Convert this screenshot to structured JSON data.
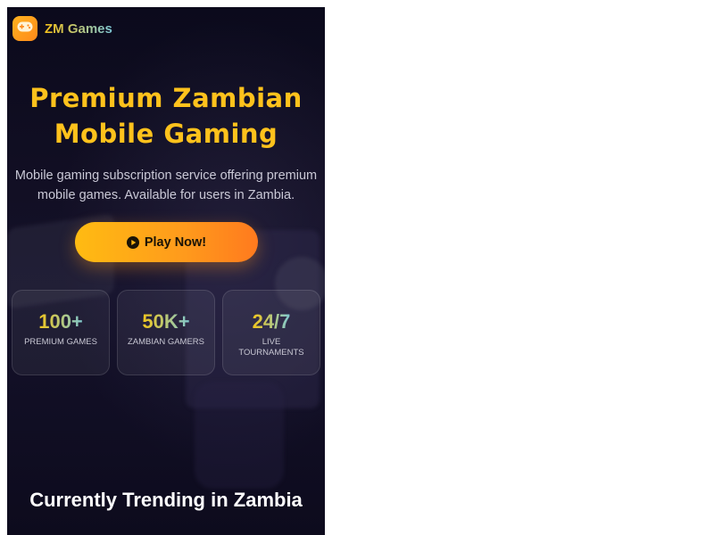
{
  "header": {
    "brand": "ZM Games",
    "logo_icon": "gamepad-icon"
  },
  "hero": {
    "title_line1": "Premium Zambian",
    "title_line2": "Mobile Gaming",
    "subtitle_line1": "Mobile gaming subscription service offering premium",
    "subtitle_line2": "mobile games. Available for users in Zambia.",
    "cta_label": "Play Now!",
    "cta_icon": "play-circle-icon"
  },
  "stats": [
    {
      "value": "100+",
      "label": "Premium Games"
    },
    {
      "value": "50K+",
      "label": "Zambian Gamers"
    },
    {
      "value": "24/7",
      "label": "Live Tournaments"
    }
  ],
  "trending": {
    "title": "Currently Trending in Zambia"
  },
  "colors": {
    "accent": "#ffc21c",
    "cta_start": "#ffbb12",
    "cta_end": "#ff7a1e",
    "background": "#0b0a1c",
    "stat_gradient_end": "#7fc9d2"
  }
}
